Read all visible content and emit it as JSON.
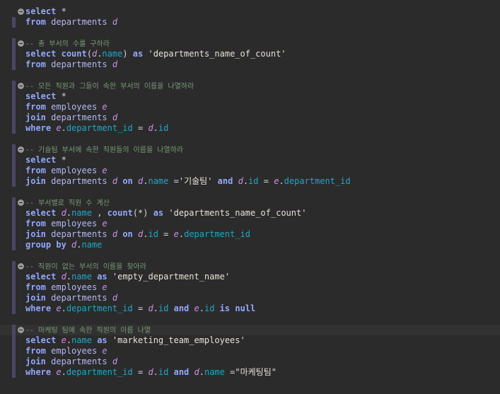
{
  "editor": {
    "colors": {
      "background": "#2b2b2b",
      "current_line": "#323232",
      "keyword": "#93a8ff",
      "identifier": "#b4b9f3",
      "alias": "#c991e6",
      "field": "#20a6c9",
      "string": "#e7e2d6",
      "comment": "#7b9a78",
      "marker": "#4c4566"
    },
    "icons": [
      "fold-collapse-icon"
    ],
    "lines": [
      {
        "fold": true,
        "tokens": [
          [
            "kw",
            "select"
          ],
          [
            "op",
            " *"
          ]
        ]
      },
      {
        "tokens": [
          [
            "kw",
            "from"
          ],
          [
            "op",
            " "
          ],
          [
            "id",
            "departments"
          ],
          [
            "op",
            " "
          ],
          [
            "al",
            "d"
          ]
        ]
      },
      {
        "tokens": []
      },
      {
        "fold": true,
        "tokens": [
          [
            "cm",
            "-- 총 부서의 수를 구하라"
          ]
        ]
      },
      {
        "tokens": [
          [
            "kw",
            "select"
          ],
          [
            "op",
            " "
          ],
          [
            "kw",
            "count"
          ],
          [
            "op",
            "("
          ],
          [
            "al",
            "d"
          ],
          [
            "op",
            "."
          ],
          [
            "fld",
            "name"
          ],
          [
            "op",
            ") "
          ],
          [
            "kw",
            "as"
          ],
          [
            "op",
            " "
          ],
          [
            "str",
            "'departments_name_of_count'"
          ]
        ]
      },
      {
        "tokens": [
          [
            "kw",
            "from"
          ],
          [
            "op",
            " "
          ],
          [
            "id",
            "departments"
          ],
          [
            "op",
            " "
          ],
          [
            "al",
            "d"
          ]
        ]
      },
      {
        "tokens": []
      },
      {
        "fold": true,
        "tokens": [
          [
            "cm",
            "-- 모든 직원과 그들이 속한 부서의 이름을 나열하라"
          ]
        ]
      },
      {
        "tokens": [
          [
            "kw",
            "select"
          ],
          [
            "op",
            " *"
          ]
        ]
      },
      {
        "tokens": [
          [
            "kw",
            "from"
          ],
          [
            "op",
            " "
          ],
          [
            "id",
            "employees"
          ],
          [
            "op",
            " "
          ],
          [
            "al",
            "e"
          ]
        ]
      },
      {
        "tokens": [
          [
            "kw",
            "join"
          ],
          [
            "op",
            " "
          ],
          [
            "id",
            "departments"
          ],
          [
            "op",
            " "
          ],
          [
            "al",
            "d"
          ]
        ]
      },
      {
        "tokens": [
          [
            "kw",
            "where"
          ],
          [
            "op",
            " "
          ],
          [
            "al",
            "e"
          ],
          [
            "op",
            "."
          ],
          [
            "fld",
            "department_id"
          ],
          [
            "op",
            " = "
          ],
          [
            "al",
            "d"
          ],
          [
            "op",
            "."
          ],
          [
            "fld",
            "id"
          ]
        ]
      },
      {
        "tokens": []
      },
      {
        "fold": true,
        "tokens": [
          [
            "cm",
            "-- 기술팀 부서에 속한 직원들의 이름을 나열하라"
          ]
        ]
      },
      {
        "tokens": [
          [
            "kw",
            "select"
          ],
          [
            "op",
            " *"
          ]
        ]
      },
      {
        "tokens": [
          [
            "kw",
            "from"
          ],
          [
            "op",
            " "
          ],
          [
            "id",
            "employees"
          ],
          [
            "op",
            " "
          ],
          [
            "al",
            "e"
          ]
        ]
      },
      {
        "tokens": [
          [
            "kw",
            "join"
          ],
          [
            "op",
            " "
          ],
          [
            "id",
            "departments"
          ],
          [
            "op",
            " "
          ],
          [
            "al",
            "d"
          ],
          [
            "op",
            " "
          ],
          [
            "kw",
            "on"
          ],
          [
            "op",
            " "
          ],
          [
            "al",
            "d"
          ],
          [
            "op",
            "."
          ],
          [
            "fld",
            "name"
          ],
          [
            "op",
            " ="
          ],
          [
            "str",
            "'기술팀'"
          ],
          [
            "op",
            " "
          ],
          [
            "kw",
            "and"
          ],
          [
            "op",
            " "
          ],
          [
            "al",
            "d"
          ],
          [
            "op",
            "."
          ],
          [
            "fld",
            "id"
          ],
          [
            "op",
            " = "
          ],
          [
            "al",
            "e"
          ],
          [
            "op",
            "."
          ],
          [
            "fld",
            "department_id"
          ]
        ]
      },
      {
        "tokens": []
      },
      {
        "fold": true,
        "tokens": [
          [
            "cm",
            "-- 부서별로 직원 수 계산"
          ]
        ]
      },
      {
        "tokens": [
          [
            "kw",
            "select"
          ],
          [
            "op",
            " "
          ],
          [
            "al",
            "d"
          ],
          [
            "op",
            "."
          ],
          [
            "fld",
            "name"
          ],
          [
            "op",
            " , "
          ],
          [
            "kw",
            "count"
          ],
          [
            "op",
            "(*) "
          ],
          [
            "kw",
            "as"
          ],
          [
            "op",
            " "
          ],
          [
            "str",
            "'departments_name_of_count'"
          ]
        ]
      },
      {
        "tokens": [
          [
            "kw",
            "from"
          ],
          [
            "op",
            " "
          ],
          [
            "id",
            "employees"
          ],
          [
            "op",
            " "
          ],
          [
            "al",
            "e"
          ]
        ]
      },
      {
        "tokens": [
          [
            "kw",
            "join"
          ],
          [
            "op",
            " "
          ],
          [
            "id",
            "departments"
          ],
          [
            "op",
            " "
          ],
          [
            "al",
            "d"
          ],
          [
            "op",
            " "
          ],
          [
            "kw",
            "on"
          ],
          [
            "op",
            " "
          ],
          [
            "al",
            "d"
          ],
          [
            "op",
            "."
          ],
          [
            "fld",
            "id"
          ],
          [
            "op",
            " = "
          ],
          [
            "al",
            "e"
          ],
          [
            "op",
            "."
          ],
          [
            "fld",
            "department_id"
          ]
        ]
      },
      {
        "tokens": [
          [
            "kw",
            "group by"
          ],
          [
            "op",
            " "
          ],
          [
            "al",
            "d"
          ],
          [
            "op",
            "."
          ],
          [
            "fld",
            "name"
          ]
        ]
      },
      {
        "tokens": []
      },
      {
        "fold": true,
        "tokens": [
          [
            "cm",
            "-- 직원이 없는 부서의 이름을 찾아라"
          ]
        ]
      },
      {
        "tokens": [
          [
            "kw",
            "select"
          ],
          [
            "op",
            " "
          ],
          [
            "al",
            "d"
          ],
          [
            "op",
            "."
          ],
          [
            "fld",
            "name"
          ],
          [
            "op",
            " "
          ],
          [
            "kw",
            "as"
          ],
          [
            "op",
            " "
          ],
          [
            "str",
            "'empty_department_name'"
          ]
        ]
      },
      {
        "tokens": [
          [
            "kw",
            "from"
          ],
          [
            "op",
            " "
          ],
          [
            "id",
            "employees"
          ],
          [
            "op",
            " "
          ],
          [
            "al",
            "e"
          ]
        ]
      },
      {
        "tokens": [
          [
            "kw",
            "join"
          ],
          [
            "op",
            " "
          ],
          [
            "id",
            "departments"
          ],
          [
            "op",
            " "
          ],
          [
            "al",
            "d"
          ]
        ]
      },
      {
        "tokens": [
          [
            "kw",
            "where"
          ],
          [
            "op",
            " "
          ],
          [
            "al",
            "e"
          ],
          [
            "op",
            "."
          ],
          [
            "fld",
            "department_id"
          ],
          [
            "op",
            " = "
          ],
          [
            "al",
            "d"
          ],
          [
            "op",
            "."
          ],
          [
            "fld",
            "id"
          ],
          [
            "op",
            " "
          ],
          [
            "kw",
            "and"
          ],
          [
            "op",
            " "
          ],
          [
            "al",
            "e"
          ],
          [
            "op",
            "."
          ],
          [
            "fld",
            "id"
          ],
          [
            "op",
            " "
          ],
          [
            "kw",
            "is"
          ],
          [
            "op",
            " "
          ],
          [
            "kw",
            "null"
          ]
        ]
      },
      {
        "tokens": []
      },
      {
        "fold": true,
        "current": true,
        "tokens": [
          [
            "cm",
            "-- 마케팅 팀에 속한 직원의 이름 나열"
          ]
        ]
      },
      {
        "tokens": [
          [
            "kw",
            "select"
          ],
          [
            "op",
            " "
          ],
          [
            "al",
            "e"
          ],
          [
            "op",
            "."
          ],
          [
            "fld",
            "name"
          ],
          [
            "op",
            " "
          ],
          [
            "kw",
            "as"
          ],
          [
            "op",
            " "
          ],
          [
            "str",
            "'marketing_team_employees'"
          ]
        ]
      },
      {
        "tokens": [
          [
            "kw",
            "from"
          ],
          [
            "op",
            " "
          ],
          [
            "id",
            "employees"
          ],
          [
            "op",
            " "
          ],
          [
            "al",
            "e"
          ]
        ]
      },
      {
        "tokens": [
          [
            "kw",
            "join"
          ],
          [
            "op",
            " "
          ],
          [
            "id",
            "departments"
          ],
          [
            "op",
            " "
          ],
          [
            "al",
            "d"
          ]
        ]
      },
      {
        "tokens": [
          [
            "kw",
            "where"
          ],
          [
            "op",
            " "
          ],
          [
            "al",
            "e"
          ],
          [
            "op",
            "."
          ],
          [
            "fld",
            "department_id"
          ],
          [
            "op",
            " = "
          ],
          [
            "al",
            "d"
          ],
          [
            "op",
            "."
          ],
          [
            "fld",
            "id"
          ],
          [
            "op",
            " "
          ],
          [
            "kw",
            "and"
          ],
          [
            "op",
            " "
          ],
          [
            "al",
            "d"
          ],
          [
            "op",
            "."
          ],
          [
            "fld",
            "name"
          ],
          [
            "op",
            " ="
          ],
          [
            "str",
            "\"마케팅팀\""
          ]
        ]
      }
    ]
  }
}
